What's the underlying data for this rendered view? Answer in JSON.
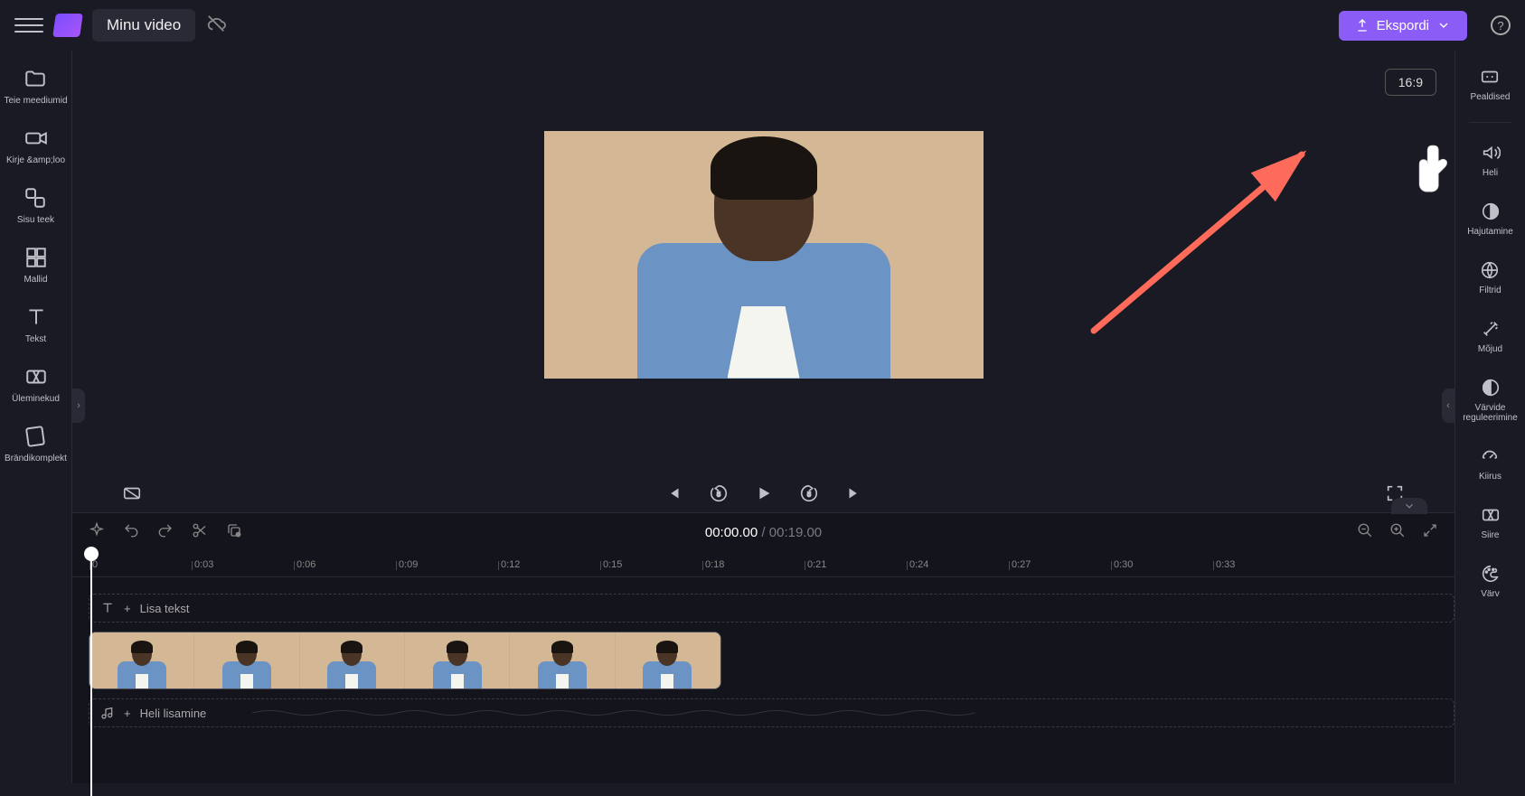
{
  "topbar": {
    "title": "Minu video",
    "export_label": "Ekspordi"
  },
  "left_sidebar": {
    "items": [
      {
        "label": "Teie meediumid"
      },
      {
        "label": "Kirje &amp;loo"
      },
      {
        "label": "Sisu teek"
      },
      {
        "label": "Mallid"
      },
      {
        "label": "Tekst"
      },
      {
        "label": "Üleminekud"
      },
      {
        "label": "Brändikomplekt"
      }
    ]
  },
  "right_sidebar": {
    "items": [
      {
        "label": "Pealdised"
      },
      {
        "label": "Heli"
      },
      {
        "label": "Hajutamine"
      },
      {
        "label": "Filtrid"
      },
      {
        "label": "Mõjud"
      },
      {
        "label": "Värvide reguleerimine"
      },
      {
        "label": "Kiirus"
      },
      {
        "label": "Siire"
      },
      {
        "label": "Värv"
      }
    ]
  },
  "stage": {
    "aspect_ratio": "16:9"
  },
  "playback": {
    "rewind_seconds": "5",
    "forward_seconds": "5"
  },
  "timeline": {
    "current_time": "00:00.00",
    "separator": " / ",
    "total_time": "00:19.00",
    "ruler_start": "0",
    "ruler": [
      "0:03",
      "0:06",
      "0:09",
      "0:12",
      "0:15",
      "0:18",
      "0:21",
      "0:24",
      "0:27",
      "0:30",
      "0:33"
    ],
    "text_track_label": "Lisa tekst",
    "audio_track_label": "Heli lisamine"
  }
}
